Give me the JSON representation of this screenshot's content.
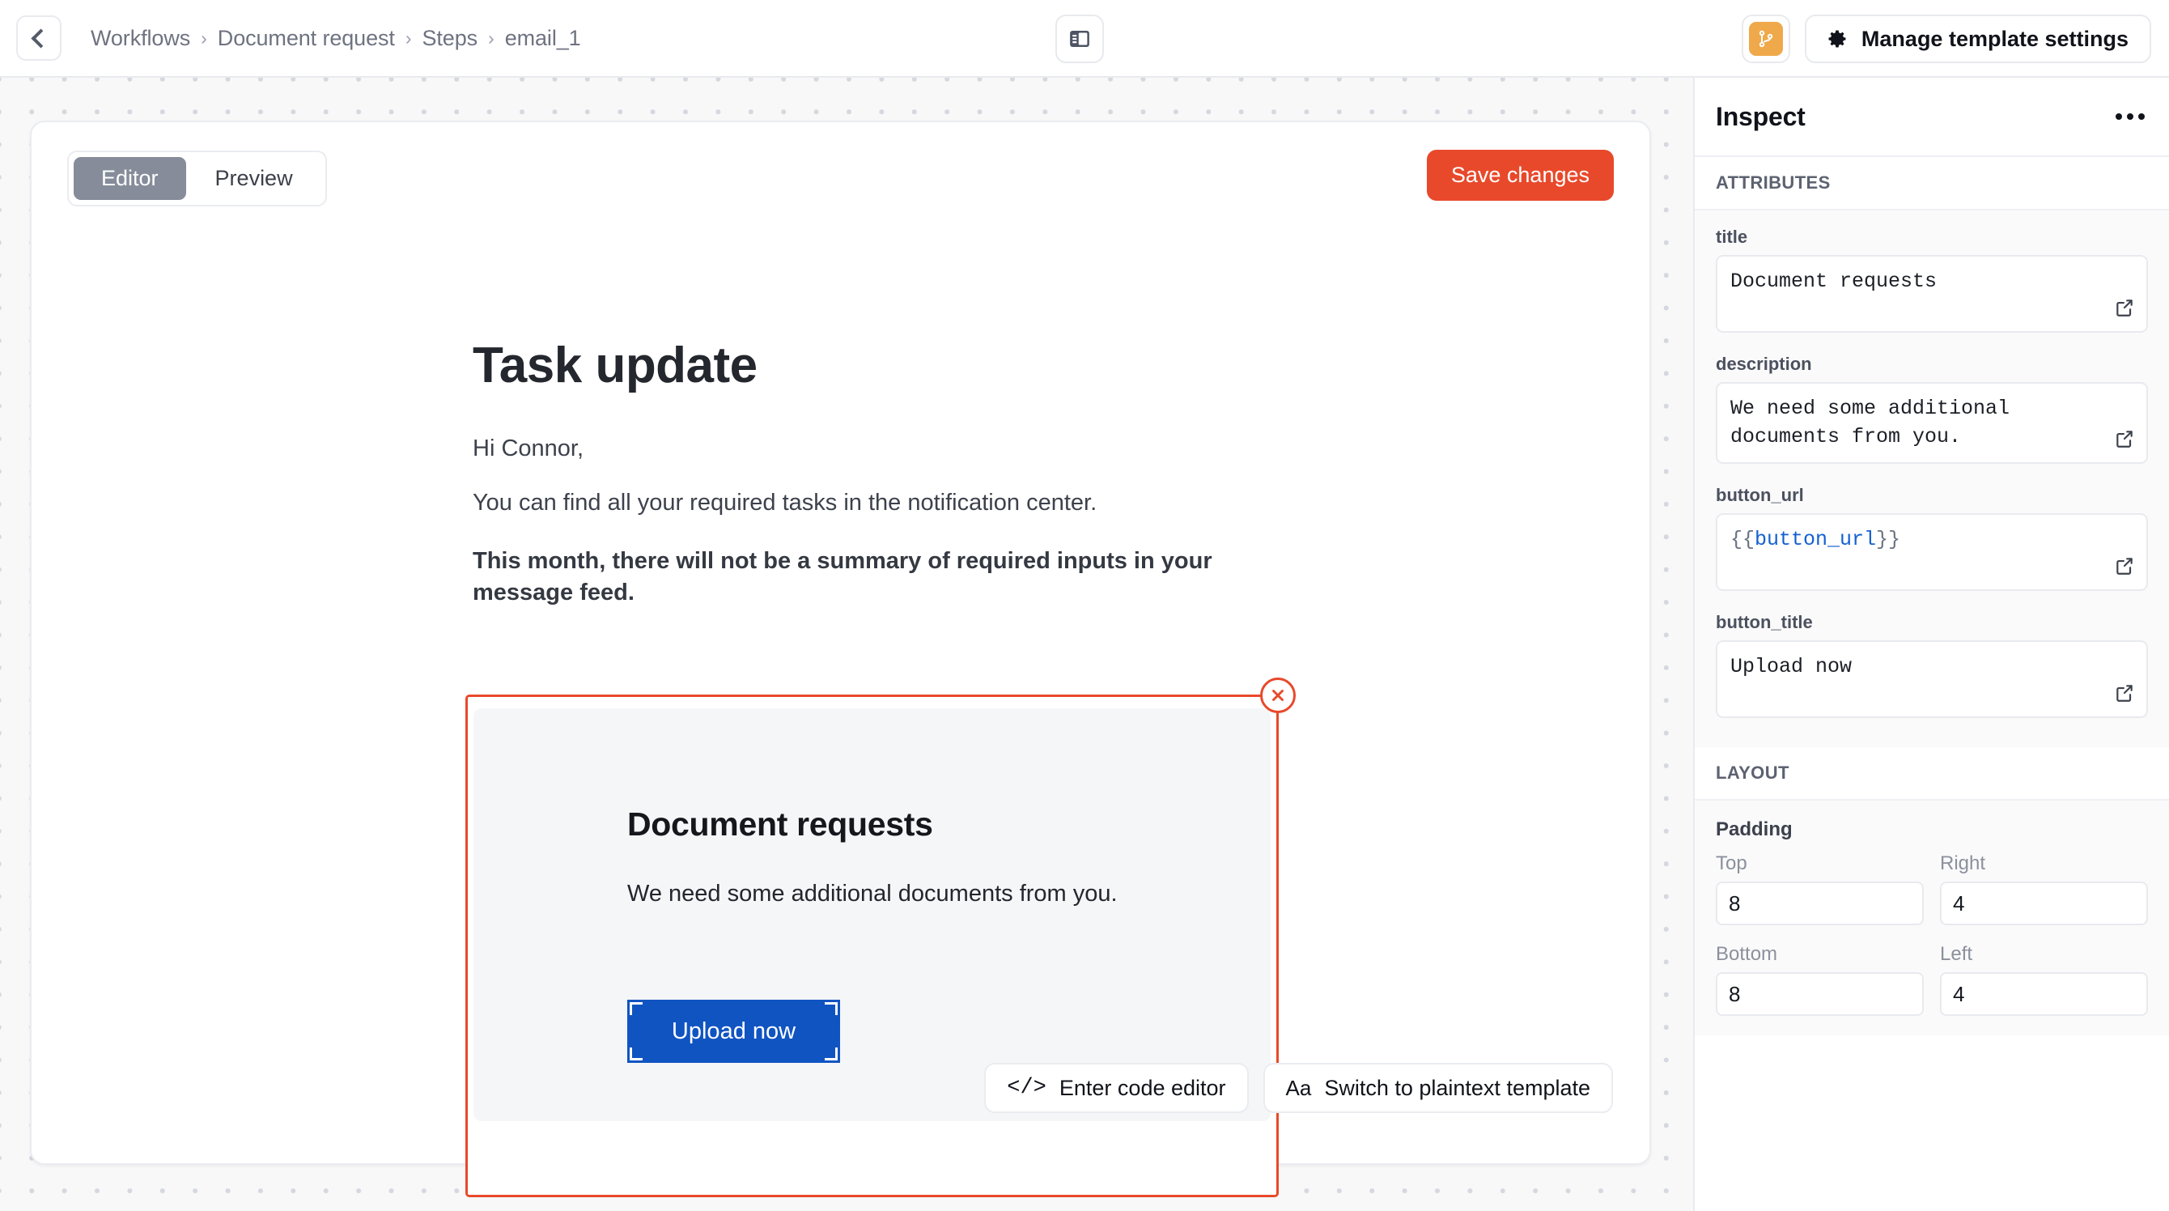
{
  "topbar": {
    "back_icon": "chevron-left-icon",
    "breadcrumb": [
      "Workflows",
      "Document request",
      "Steps",
      "email_1"
    ],
    "separator": "›",
    "panel_toggle_icon": "sidebar-panel-icon",
    "branch_icon": "git-branch-icon",
    "branch_color": "#efa94a",
    "manage_icon": "gear-icon",
    "manage_label": "Manage template settings"
  },
  "editor": {
    "tabs": [
      {
        "label": "Editor",
        "active": true
      },
      {
        "label": "Preview",
        "active": false
      }
    ],
    "save_label": "Save changes",
    "save_color": "#e8492b",
    "email": {
      "heading": "Task update",
      "greeting": "Hi Connor,",
      "paragraph": "You can find all your required tasks in the notification center.",
      "bold_paragraph": "This month, there will not be a summary of required inputs in your message feed."
    },
    "selected_block": {
      "close_icon": "close-circle-icon",
      "selection_color": "#e8492b",
      "card_title": "Document requests",
      "card_description": "We need some additional documents from you.",
      "button_label": "Upload now",
      "button_color": "#1054c2"
    },
    "footer_buttons": [
      {
        "icon": "code-icon",
        "glyph": "</>",
        "label": "Enter code editor"
      },
      {
        "icon": "text-format-icon",
        "glyph": "Aa",
        "label": "Switch to plaintext template"
      }
    ]
  },
  "inspect": {
    "title": "Inspect",
    "more_icon": "more-horizontal-icon",
    "sections": [
      {
        "heading": "ATTRIBUTES"
      },
      {
        "heading": "LAYOUT"
      }
    ],
    "attributes": [
      {
        "label": "title",
        "value": "Document requests",
        "open_icon": "external-link-icon"
      },
      {
        "label": "description",
        "value": "We need some additional documents from you.",
        "open_icon": "external-link-icon"
      },
      {
        "label": "button_url",
        "value": "{{button_url}}",
        "variable": "button_url",
        "open_icon": "external-link-icon"
      },
      {
        "label": "button_title",
        "value": "Upload now",
        "open_icon": "external-link-icon"
      }
    ],
    "layout": {
      "padding_title": "Padding",
      "fields": [
        {
          "label": "Top",
          "value": "8"
        },
        {
          "label": "Right",
          "value": "4"
        },
        {
          "label": "Bottom",
          "value": "8"
        },
        {
          "label": "Left",
          "value": "4"
        }
      ]
    }
  }
}
